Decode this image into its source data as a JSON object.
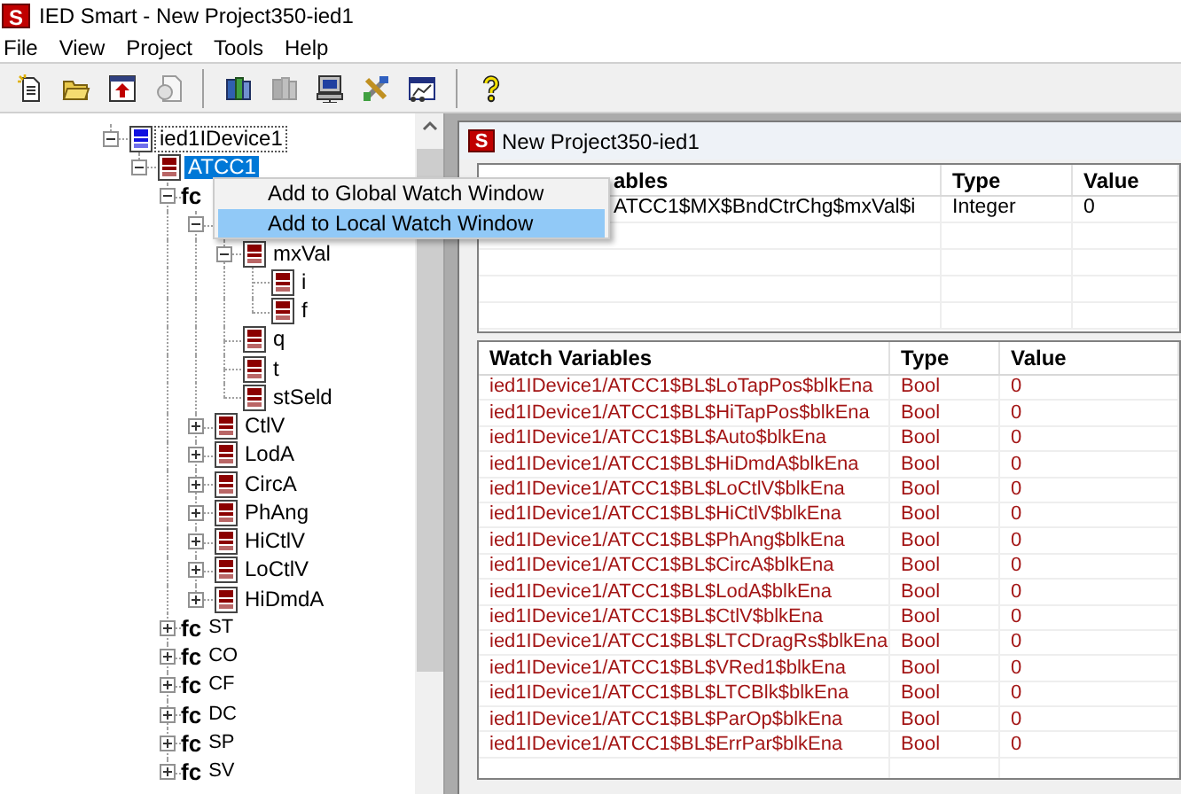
{
  "window": {
    "icon_text": "S",
    "title": "IED Smart - New Project350-ied1"
  },
  "menu": [
    "File",
    "View",
    "Project",
    "Tools",
    "Help"
  ],
  "toolbar": [
    {
      "kind": "new",
      "disabled": false
    },
    {
      "kind": "open",
      "disabled": false
    },
    {
      "kind": "upload",
      "disabled": false
    },
    {
      "kind": "document",
      "disabled": true
    },
    {
      "kind": "separator"
    },
    {
      "kind": "books",
      "disabled": false
    },
    {
      "kind": "books",
      "disabled": true
    },
    {
      "kind": "computer",
      "disabled": false
    },
    {
      "kind": "tools",
      "disabled": false
    },
    {
      "kind": "chart-window",
      "disabled": false
    },
    {
      "kind": "separator"
    },
    {
      "kind": "help",
      "disabled": false
    }
  ],
  "tree": [
    {
      "kind": "device",
      "label": "ied1IDevice1",
      "expanded": true,
      "selected": false,
      "children": [
        {
          "kind": "node",
          "label": "ATCC1",
          "expanded": true,
          "selected": true,
          "children": [
            {
              "kind": "fc",
              "prefix": "fc",
              "expanded": true,
              "selected": false,
              "children": [
                {
                  "kind": "group",
                  "expanded": true,
                  "children": [
                    {
                      "kind": "node",
                      "label": "mxVal",
                      "expanded": true,
                      "selected": false,
                      "children": [
                        {
                          "kind": "node",
                          "label": "i",
                          "selected": false
                        },
                        {
                          "kind": "node",
                          "label": "f",
                          "selected": false
                        }
                      ]
                    },
                    {
                      "kind": "node",
                      "label": "q",
                      "selected": false
                    },
                    {
                      "kind": "node",
                      "label": "t",
                      "selected": false
                    },
                    {
                      "kind": "node",
                      "label": "stSeld",
                      "selected": false
                    }
                  ]
                },
                {
                  "kind": "node",
                  "label": "CtlV",
                  "expanded": false,
                  "selected": false
                },
                {
                  "kind": "node",
                  "label": "LodA",
                  "expanded": false,
                  "selected": false
                },
                {
                  "kind": "node",
                  "label": "CircA",
                  "expanded": false,
                  "selected": false
                },
                {
                  "kind": "node",
                  "label": "PhAng",
                  "expanded": false,
                  "selected": false
                },
                {
                  "kind": "node",
                  "label": "HiCtlV",
                  "expanded": false,
                  "selected": false
                },
                {
                  "kind": "node",
                  "label": "LoCtlV",
                  "expanded": false,
                  "selected": false
                },
                {
                  "kind": "node",
                  "label": "HiDmdA",
                  "expanded": false,
                  "selected": false
                }
              ]
            },
            {
              "kind": "fc",
              "prefix": "fc",
              "label": "ST",
              "expanded": false,
              "selected": false
            },
            {
              "kind": "fc",
              "prefix": "fc",
              "label": "CO",
              "expanded": false,
              "selected": false
            },
            {
              "kind": "fc",
              "prefix": "fc",
              "label": "CF",
              "expanded": false,
              "selected": false
            },
            {
              "kind": "fc",
              "prefix": "fc",
              "label": "DC",
              "expanded": false,
              "selected": false
            },
            {
              "kind": "fc",
              "prefix": "fc",
              "label": "SP",
              "expanded": false,
              "selected": false
            },
            {
              "kind": "fc",
              "prefix": "fc",
              "label": "SV",
              "expanded": false,
              "selected": false
            }
          ]
        }
      ]
    }
  ],
  "context_menu": [
    {
      "label": "Add to Global Watch Window",
      "selected": false
    },
    {
      "label": "Add to Local Watch Window",
      "selected": true
    }
  ],
  "child_window": {
    "icon_text": "S",
    "title": "New Project350-ied1"
  },
  "local_watch": {
    "columns": [
      "ables",
      "Type",
      "Value"
    ],
    "rows": [
      [
        "ATCC1$MX$BndCtrChg$mxVal$i",
        "Integer",
        "0"
      ]
    ]
  },
  "watch": {
    "columns": [
      "Watch Variables",
      "Type",
      "Value"
    ],
    "rows": [
      [
        "ied1IDevice1/ATCC1$BL$LoTapPos$blkEna",
        "Bool",
        "0"
      ],
      [
        "ied1IDevice1/ATCC1$BL$HiTapPos$blkEna",
        "Bool",
        "0"
      ],
      [
        "ied1IDevice1/ATCC1$BL$Auto$blkEna",
        "Bool",
        "0"
      ],
      [
        "ied1IDevice1/ATCC1$BL$HiDmdA$blkEna",
        "Bool",
        "0"
      ],
      [
        "ied1IDevice1/ATCC1$BL$LoCtlV$blkEna",
        "Bool",
        "0"
      ],
      [
        "ied1IDevice1/ATCC1$BL$HiCtlV$blkEna",
        "Bool",
        "0"
      ],
      [
        "ied1IDevice1/ATCC1$BL$PhAng$blkEna",
        "Bool",
        "0"
      ],
      [
        "ied1IDevice1/ATCC1$BL$CircA$blkEna",
        "Bool",
        "0"
      ],
      [
        "ied1IDevice1/ATCC1$BL$LodA$blkEna",
        "Bool",
        "0"
      ],
      [
        "ied1IDevice1/ATCC1$BL$CtlV$blkEna",
        "Bool",
        "0"
      ],
      [
        "ied1IDevice1/ATCC1$BL$LTCDragRs$blkEna",
        "Bool",
        "0"
      ],
      [
        "ied1IDevice1/ATCC1$BL$VRed1$blkEna",
        "Bool",
        "0"
      ],
      [
        "ied1IDevice1/ATCC1$BL$LTCBlk$blkEna",
        "Bool",
        "0"
      ],
      [
        "ied1IDevice1/ATCC1$BL$ParOp$blkEna",
        "Bool",
        "0"
      ],
      [
        "ied1IDevice1/ATCC1$BL$ErrPar$blkEna",
        "Bool",
        "0"
      ]
    ]
  }
}
